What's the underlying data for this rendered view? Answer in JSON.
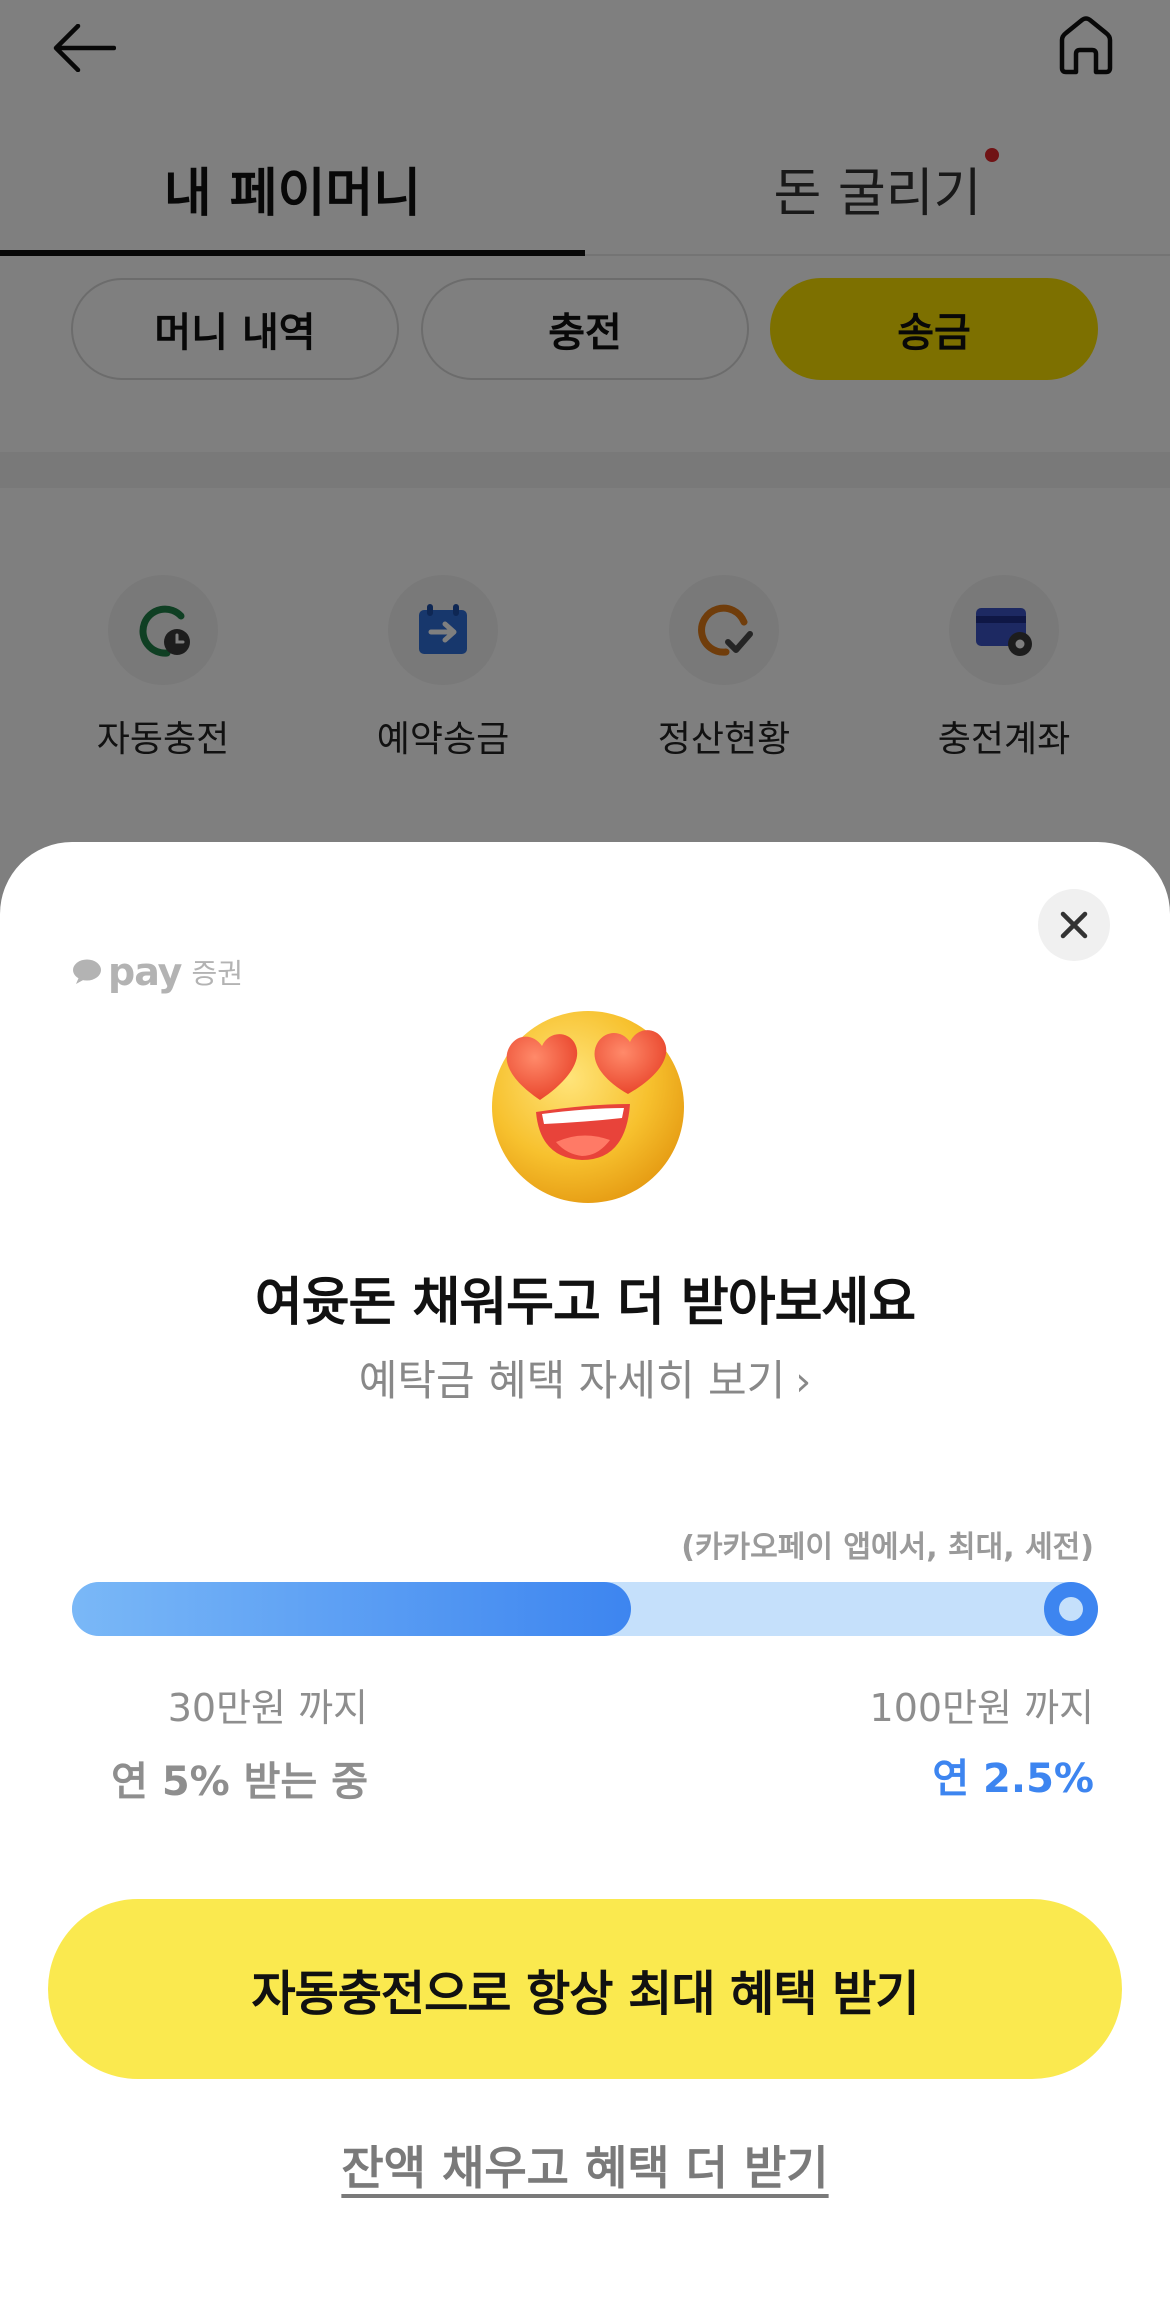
{
  "header": {
    "back_icon": "arrow-left-icon",
    "home_icon": "home-icon"
  },
  "tabs": [
    {
      "label": "내 페이머니",
      "active": true
    },
    {
      "label": "돈 굴리기",
      "has_new_dot": true
    }
  ],
  "chips": [
    {
      "label": "머니 내역"
    },
    {
      "label": "충전"
    },
    {
      "label": "송금",
      "highlighted": true
    }
  ],
  "quick_menu": [
    {
      "label": "자동충전",
      "icon": "auto-charge-icon"
    },
    {
      "label": "예약송금",
      "icon": "scheduled-transfer-icon"
    },
    {
      "label": "정산현황",
      "icon": "settlement-status-icon"
    },
    {
      "label": "충전계좌",
      "icon": "charge-account-icon"
    }
  ],
  "sheet": {
    "brand_pay": "pay",
    "brand_sub": "증권",
    "emoji": "heart-eyes-emoji",
    "title": "여윳돈 채워두고 더 받아보세요",
    "detail_link": "예탁금 혜택 자세히 보기",
    "note": "(카카오페이 앱에서, 최대, 세전)",
    "progress_fraction": 0.545,
    "left_level": {
      "limit": "30만원 까지",
      "rate": "연 5% 받는 중"
    },
    "right_level": {
      "limit": "100만원 까지",
      "rate": "연 2.5%"
    },
    "cta_label": "자동충전으로 항상 최대 혜택 받기",
    "secondary_label": "잔액 채우고 혜택 더 받기"
  },
  "colors": {
    "kakao_yellow": "#fae100",
    "cta_yellow": "#fae94f",
    "progress_blue": "#3d85f0",
    "progress_track": "#c5e0fb",
    "dot_red": "#e0262a"
  }
}
